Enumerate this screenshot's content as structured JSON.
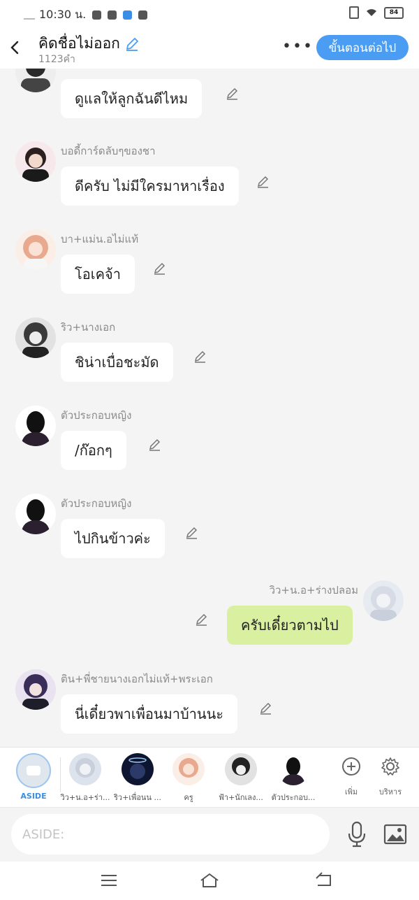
{
  "status_bar": {
    "time": "10:30 น.",
    "battery": "84"
  },
  "header": {
    "title": "คิดชื่อไม่ออก",
    "subtitle": "1123คำ",
    "more": "•••",
    "next_label": "ขั้นตอนต่อไป"
  },
  "messages": [
    {
      "name": "",
      "text": "ดูแลให้ลูกฉันดีไหม",
      "side": "left"
    },
    {
      "name": "บอดี้การ์ดลับๆของชา",
      "text": "ดีครับ ไม่มีใครมาหาเรื่อง",
      "side": "left"
    },
    {
      "name": "บา+แม่น.อไม่แท้",
      "text": "โอเคจ้า",
      "side": "left"
    },
    {
      "name": "ริว+นางเอก",
      "text": "ชิน่าเบื่อชะมัด",
      "side": "left"
    },
    {
      "name": "ตัวประกอบหญิง",
      "text": "/ก๊อกๆ",
      "side": "left"
    },
    {
      "name": "ตัวประกอบหญิง",
      "text": "ไปกินข้าวค่ะ",
      "side": "left"
    },
    {
      "name": "วิว+น.อ+ร่างปลอม",
      "text": "ครับเดี๋ยวตามไป",
      "side": "right"
    },
    {
      "name": "ติน+พี่ชายนางเอกไม่แท้+พระเอก",
      "text": "นี่เดี๋ยวพาเพื่อนมาบ้านนะ",
      "side": "left"
    }
  ],
  "character_bar": {
    "aside_label": "ASIDE",
    "characters": [
      "วิว+น.อ+ร่า...",
      "ริว+เพื่อนน ...",
      "ครู",
      "ฟ้า+นักเลง...",
      "ตัวประกอบ..."
    ],
    "add_label": "เพิ่ม",
    "manage_label": "บริหาร"
  },
  "input": {
    "placeholder": "ASIDE:"
  },
  "colors": {
    "accent": "#4a9df2",
    "mine_bubble": "#d8f0a0",
    "background": "#f4f4f4"
  }
}
